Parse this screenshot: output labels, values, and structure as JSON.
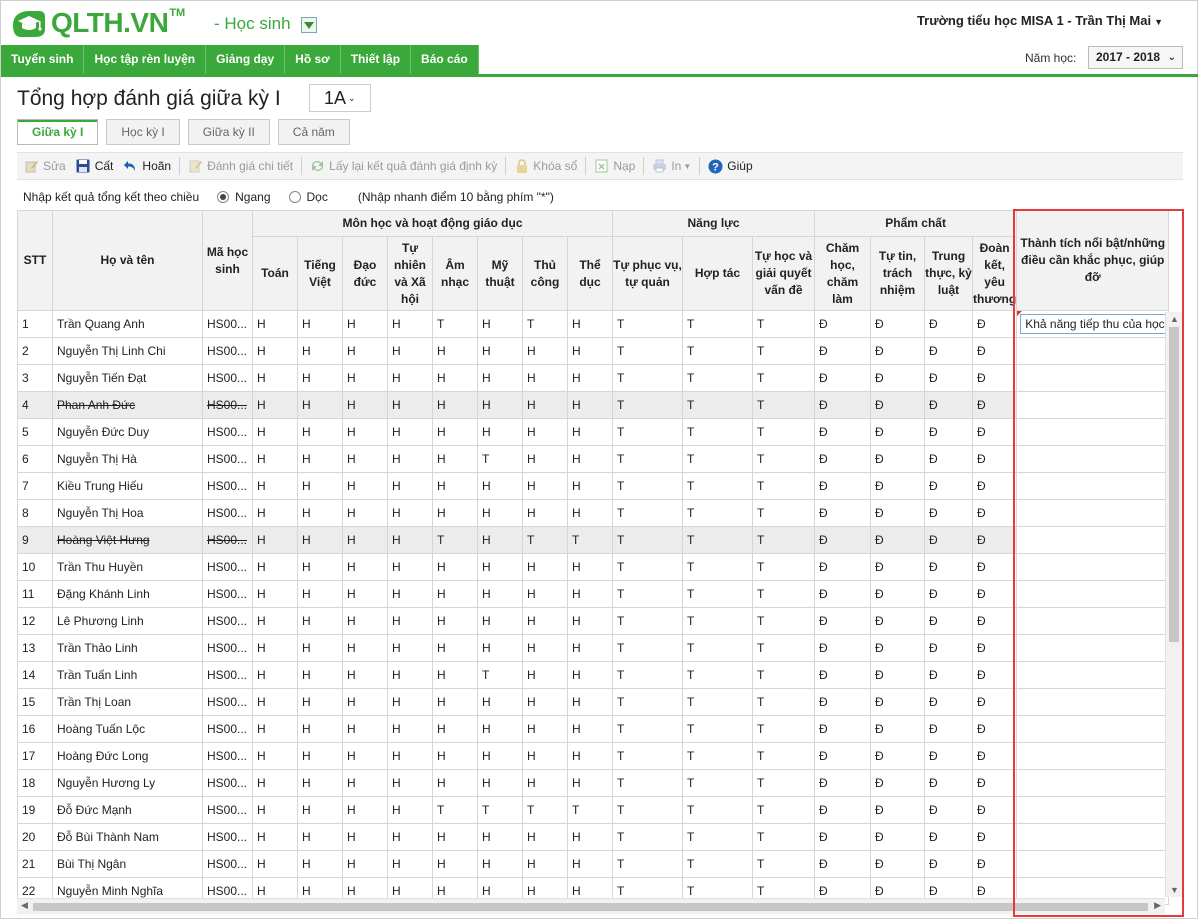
{
  "header": {
    "logo_text": "QLTH.VN",
    "logo_tm": "TM",
    "role": "- Học sinh",
    "user": "Trường tiểu học MISA 1 - Trần Thị Mai"
  },
  "nav": {
    "items": [
      "Tuyển sinh",
      "Học tập rèn luyện",
      "Giảng dạy",
      "Hồ sơ",
      "Thiết lập",
      "Báo cáo"
    ],
    "year_label": "Năm học:",
    "year_value": "2017 - 2018"
  },
  "page": {
    "title": "Tổng hợp đánh giá giữa kỳ I",
    "class_value": "1A"
  },
  "tabs": [
    "Giữa kỳ I",
    "Học kỳ I",
    "Giữa kỳ II",
    "Cả năm"
  ],
  "toolbar": {
    "edit": "Sửa",
    "save": "Cất",
    "undo": "Hoãn",
    "detail": "Đánh giá chi tiết",
    "reload": "Lấy lại kết quả đánh giá định kỳ",
    "lock": "Khóa sổ",
    "import": "Nạp",
    "print": "In",
    "help": "Giúp"
  },
  "direction": {
    "label": "Nhập kết quả tổng kết theo chiều",
    "horizontal": "Ngang",
    "vertical": "Dọc",
    "hint": "(Nhập nhanh điểm 10 bằng phím \"*\")"
  },
  "columns": {
    "stt": "STT",
    "name": "Họ và tên",
    "code": "Mã học sinh",
    "group_subjects": "Môn học và hoạt động giáo dục",
    "group_ability": "Năng lực",
    "group_quality": "Phẩm chất",
    "achievement": "Thành tích nổi bật/những điều cần khắc phục, giúp đỡ",
    "subjects": [
      "Toán",
      "Tiếng Việt",
      "Đạo đức",
      "Tự nhiên và Xã hội",
      "Âm nhạc",
      "Mỹ thuật",
      "Thủ công",
      "Thể dục"
    ],
    "abilities": [
      "Tự phục vụ, tự quản",
      "Hợp tác",
      "Tự học và giải quyết vấn đề"
    ],
    "qualities": [
      "Chăm học, chăm làm",
      "Tự tin, trách nhiệm",
      "Trung thực, kỷ luật",
      "Đoàn kết, yêu thương"
    ]
  },
  "rows": [
    {
      "stt": "1",
      "name": "Trần Quang Anh",
      "code": "HS00...",
      "s": [
        "H",
        "H",
        "H",
        "H",
        "T",
        "H",
        "T",
        "H"
      ],
      "a": [
        "T",
        "T",
        "T"
      ],
      "q": [
        "Đ",
        "Đ",
        "Đ",
        "Đ"
      ],
      "note": "Khả năng tiếp thu của học sinh"
    },
    {
      "stt": "2",
      "name": "Nguyễn Thị Linh Chi",
      "code": "HS00...",
      "s": [
        "H",
        "H",
        "H",
        "H",
        "H",
        "H",
        "H",
        "H"
      ],
      "a": [
        "T",
        "T",
        "T"
      ],
      "q": [
        "Đ",
        "Đ",
        "Đ",
        "Đ"
      ],
      "note": ""
    },
    {
      "stt": "3",
      "name": "Nguyễn Tiến Đạt",
      "code": "HS00...",
      "s": [
        "H",
        "H",
        "H",
        "H",
        "H",
        "H",
        "H",
        "H"
      ],
      "a": [
        "T",
        "T",
        "T"
      ],
      "q": [
        "Đ",
        "Đ",
        "Đ",
        "Đ"
      ],
      "note": ""
    },
    {
      "stt": "4",
      "name": "Phan Anh Đức",
      "code": "HS00...",
      "s": [
        "H",
        "H",
        "H",
        "H",
        "H",
        "H",
        "H",
        "H"
      ],
      "a": [
        "T",
        "T",
        "T"
      ],
      "q": [
        "Đ",
        "Đ",
        "Đ",
        "Đ"
      ],
      "note": "",
      "strike": true
    },
    {
      "stt": "5",
      "name": "Nguyễn Đức Duy",
      "code": "HS00...",
      "s": [
        "H",
        "H",
        "H",
        "H",
        "H",
        "H",
        "H",
        "H"
      ],
      "a": [
        "T",
        "T",
        "T"
      ],
      "q": [
        "Đ",
        "Đ",
        "Đ",
        "Đ"
      ],
      "note": ""
    },
    {
      "stt": "6",
      "name": "Nguyễn Thị Hà",
      "code": "HS00...",
      "s": [
        "H",
        "H",
        "H",
        "H",
        "H",
        "T",
        "H",
        "H"
      ],
      "a": [
        "T",
        "T",
        "T"
      ],
      "q": [
        "Đ",
        "Đ",
        "Đ",
        "Đ"
      ],
      "note": ""
    },
    {
      "stt": "7",
      "name": "Kiều Trung Hiếu",
      "code": "HS00...",
      "s": [
        "H",
        "H",
        "H",
        "H",
        "H",
        "H",
        "H",
        "H"
      ],
      "a": [
        "T",
        "T",
        "T"
      ],
      "q": [
        "Đ",
        "Đ",
        "Đ",
        "Đ"
      ],
      "note": ""
    },
    {
      "stt": "8",
      "name": "Nguyễn Thị Hoa",
      "code": "HS00...",
      "s": [
        "H",
        "H",
        "H",
        "H",
        "H",
        "H",
        "H",
        "H"
      ],
      "a": [
        "T",
        "T",
        "T"
      ],
      "q": [
        "Đ",
        "Đ",
        "Đ",
        "Đ"
      ],
      "note": ""
    },
    {
      "stt": "9",
      "name": "Hoàng Việt Hưng",
      "code": "HS00...",
      "s": [
        "H",
        "H",
        "H",
        "H",
        "T",
        "H",
        "T",
        "T"
      ],
      "a": [
        "T",
        "T",
        "T"
      ],
      "q": [
        "Đ",
        "Đ",
        "Đ",
        "Đ"
      ],
      "note": "",
      "strike": true
    },
    {
      "stt": "10",
      "name": "Trần Thu Huyền",
      "code": "HS00...",
      "s": [
        "H",
        "H",
        "H",
        "H",
        "H",
        "H",
        "H",
        "H"
      ],
      "a": [
        "T",
        "T",
        "T"
      ],
      "q": [
        "Đ",
        "Đ",
        "Đ",
        "Đ"
      ],
      "note": ""
    },
    {
      "stt": "11",
      "name": "Đặng Khánh Linh",
      "code": "HS00...",
      "s": [
        "H",
        "H",
        "H",
        "H",
        "H",
        "H",
        "H",
        "H"
      ],
      "a": [
        "T",
        "T",
        "T"
      ],
      "q": [
        "Đ",
        "Đ",
        "Đ",
        "Đ"
      ],
      "note": ""
    },
    {
      "stt": "12",
      "name": "Lê Phương Linh",
      "code": "HS00...",
      "s": [
        "H",
        "H",
        "H",
        "H",
        "H",
        "H",
        "H",
        "H"
      ],
      "a": [
        "T",
        "T",
        "T"
      ],
      "q": [
        "Đ",
        "Đ",
        "Đ",
        "Đ"
      ],
      "note": ""
    },
    {
      "stt": "13",
      "name": "Trần Thảo Linh",
      "code": "HS00...",
      "s": [
        "H",
        "H",
        "H",
        "H",
        "H",
        "H",
        "H",
        "H"
      ],
      "a": [
        "T",
        "T",
        "T"
      ],
      "q": [
        "Đ",
        "Đ",
        "Đ",
        "Đ"
      ],
      "note": ""
    },
    {
      "stt": "14",
      "name": "Trần Tuấn Linh",
      "code": "HS00...",
      "s": [
        "H",
        "H",
        "H",
        "H",
        "H",
        "T",
        "H",
        "H"
      ],
      "a": [
        "T",
        "T",
        "T"
      ],
      "q": [
        "Đ",
        "Đ",
        "Đ",
        "Đ"
      ],
      "note": ""
    },
    {
      "stt": "15",
      "name": "Trần Thị Loan",
      "code": "HS00...",
      "s": [
        "H",
        "H",
        "H",
        "H",
        "H",
        "H",
        "H",
        "H"
      ],
      "a": [
        "T",
        "T",
        "T"
      ],
      "q": [
        "Đ",
        "Đ",
        "Đ",
        "Đ"
      ],
      "note": ""
    },
    {
      "stt": "16",
      "name": "Hoàng Tuấn Lộc",
      "code": "HS00...",
      "s": [
        "H",
        "H",
        "H",
        "H",
        "H",
        "H",
        "H",
        "H"
      ],
      "a": [
        "T",
        "T",
        "T"
      ],
      "q": [
        "Đ",
        "Đ",
        "Đ",
        "Đ"
      ],
      "note": ""
    },
    {
      "stt": "17",
      "name": "Hoàng Đức Long",
      "code": "HS00...",
      "s": [
        "H",
        "H",
        "H",
        "H",
        "H",
        "H",
        "H",
        "H"
      ],
      "a": [
        "T",
        "T",
        "T"
      ],
      "q": [
        "Đ",
        "Đ",
        "Đ",
        "Đ"
      ],
      "note": ""
    },
    {
      "stt": "18",
      "name": "Nguyễn Hương Ly",
      "code": "HS00...",
      "s": [
        "H",
        "H",
        "H",
        "H",
        "H",
        "H",
        "H",
        "H"
      ],
      "a": [
        "T",
        "T",
        "T"
      ],
      "q": [
        "Đ",
        "Đ",
        "Đ",
        "Đ"
      ],
      "note": ""
    },
    {
      "stt": "19",
      "name": "Đỗ Đức Mạnh",
      "code": "HS00...",
      "s": [
        "H",
        "H",
        "H",
        "H",
        "T",
        "T",
        "T",
        "T"
      ],
      "a": [
        "T",
        "T",
        "T"
      ],
      "q": [
        "Đ",
        "Đ",
        "Đ",
        "Đ"
      ],
      "note": ""
    },
    {
      "stt": "20",
      "name": "Đỗ Bùi Thành Nam",
      "code": "HS00...",
      "s": [
        "H",
        "H",
        "H",
        "H",
        "H",
        "H",
        "H",
        "H"
      ],
      "a": [
        "T",
        "T",
        "T"
      ],
      "q": [
        "Đ",
        "Đ",
        "Đ",
        "Đ"
      ],
      "note": ""
    },
    {
      "stt": "21",
      "name": "Bùi Thị Ngân",
      "code": "HS00...",
      "s": [
        "H",
        "H",
        "H",
        "H",
        "H",
        "H",
        "H",
        "H"
      ],
      "a": [
        "T",
        "T",
        "T"
      ],
      "q": [
        "Đ",
        "Đ",
        "Đ",
        "Đ"
      ],
      "note": ""
    },
    {
      "stt": "22",
      "name": "Nguyễn Minh Nghĩa",
      "code": "HS00...",
      "s": [
        "H",
        "H",
        "H",
        "H",
        "H",
        "H",
        "H",
        "H"
      ],
      "a": [
        "T",
        "T",
        "T"
      ],
      "q": [
        "Đ",
        "Đ",
        "Đ",
        "Đ"
      ],
      "note": ""
    }
  ],
  "colors": {
    "brand_green": "#3aa83a",
    "highlight_red": "#e33b3b"
  }
}
